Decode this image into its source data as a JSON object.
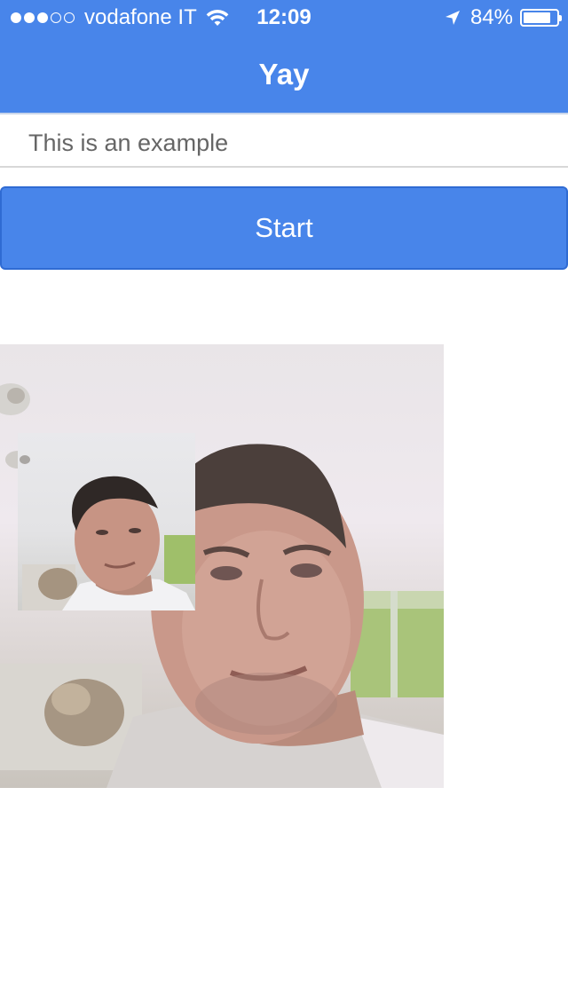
{
  "status_bar": {
    "signal_strength": 3,
    "signal_total": 5,
    "carrier": "vodafone IT",
    "time": "12:09",
    "battery_percent": "84%",
    "battery_level": 0.84,
    "icons": [
      "signal-dots-icon",
      "wifi-icon",
      "location-arrow-icon",
      "battery-icon"
    ]
  },
  "nav": {
    "title": "Yay"
  },
  "form": {
    "text_value": "This is an example",
    "start_label": "Start"
  },
  "colors": {
    "bar": "#4885ea",
    "button": "#4885ea",
    "button_border": "#2f6bd3",
    "field_text": "#666666"
  }
}
